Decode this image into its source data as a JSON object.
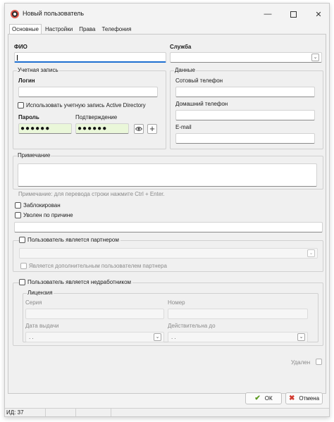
{
  "window": {
    "title": "Новый пользователь"
  },
  "tabs": [
    {
      "label": "Основные"
    },
    {
      "label": "Настройки"
    },
    {
      "label": "Права"
    },
    {
      "label": "Телефония"
    }
  ],
  "main": {
    "fio_label": "ФИО",
    "fio_value": "",
    "service_label": "Служба",
    "service_value": ""
  },
  "account": {
    "caption": "Учетная запись",
    "login_label": "Логин",
    "login_value": "",
    "use_ad_label": "Использовать учетную запись Active Directory",
    "password_label": "Пароль",
    "password_value": "●●●●●●",
    "confirm_label": "Подтверждение",
    "confirm_value": "●●●●●●"
  },
  "contacts": {
    "caption": "Данные",
    "mobile_label": "Сотовый телефон",
    "home_label": "Домашний телефон",
    "email_label": "E-mail"
  },
  "note": {
    "caption": "Примечание",
    "hint": "Примечание: для перевода строки нажмите Ctrl + Enter."
  },
  "flags": {
    "blocked_label": "Заблокирован",
    "fired_label": "Уволен по причине"
  },
  "partner": {
    "is_partner_label": "Пользователь является партнером",
    "additional_label": "Является дополнительным пользователем партнера"
  },
  "nondev": {
    "is_nondev_label": "Пользователь является недработником",
    "license_caption": "Лицензия",
    "series_label": "Серия",
    "number_label": "Номер",
    "issue_date_label": "Дата выдачи",
    "issue_date_value": ". .",
    "valid_to_label": "Действительна до",
    "valid_to_value": ". ."
  },
  "deleted_label": "Удален",
  "buttons": {
    "ok": "ОК",
    "cancel": "Отмена"
  },
  "status": {
    "id_label": "ИД: 37"
  },
  "icons": {
    "app": "app-icon",
    "minimize": "minimize-icon",
    "maximize": "maximize-icon",
    "close": "close-icon",
    "eye": "eye-icon",
    "plus": "plus-icon",
    "ok": "checkmark-icon",
    "cancel": "cross-icon",
    "dropdown": "chevron-down-icon"
  },
  "colors": {
    "password_bg": "#eaf7d9",
    "focus_accent": "#1e6fd0",
    "ok_icon": "#5a9a1d",
    "cancel_icon": "#d23a2f"
  }
}
